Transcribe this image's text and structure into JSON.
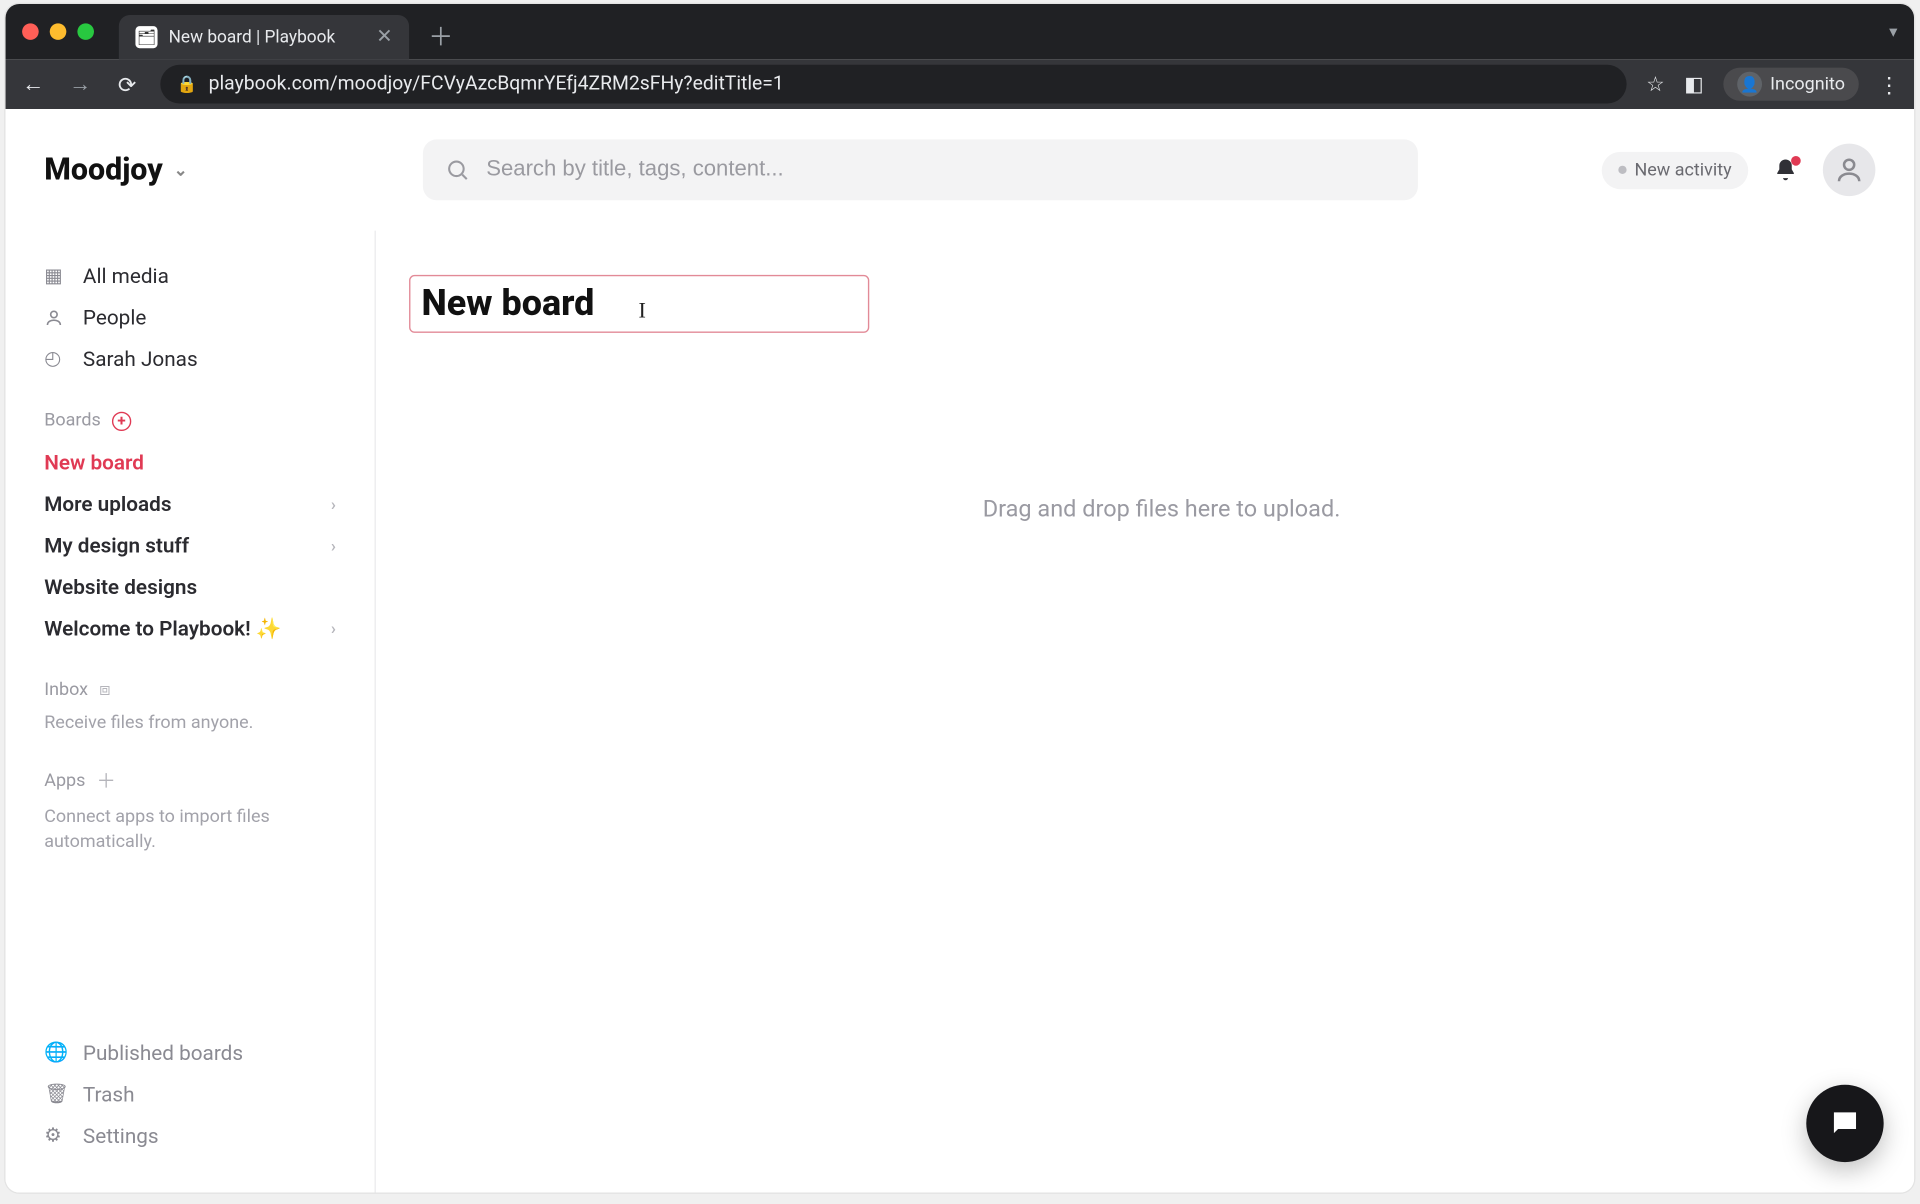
{
  "browser": {
    "tab_title": "New board | Playbook",
    "url": "playbook.com/moodjoy/FCVyAzcBqmrYEfj4ZRM2sFHy?editTitle=1",
    "incognito_label": "Incognito"
  },
  "header": {
    "workspace_name": "Moodjoy",
    "search_placeholder": "Search by title, tags, content...",
    "activity_label": "New activity"
  },
  "sidebar": {
    "nav": [
      {
        "icon": "grid",
        "label": "All media"
      },
      {
        "icon": "person",
        "label": "People"
      },
      {
        "icon": "clock",
        "label": "Sarah Jonas"
      }
    ],
    "boards_header": "Boards",
    "boards": [
      {
        "label": "New board",
        "active": true,
        "expandable": false
      },
      {
        "label": "More uploads",
        "active": false,
        "expandable": true
      },
      {
        "label": "My design stuff",
        "active": false,
        "expandable": true
      },
      {
        "label": "Website designs",
        "active": false,
        "expandable": false
      },
      {
        "label": "Welcome to Playbook! ✨",
        "active": false,
        "expandable": true
      }
    ],
    "inbox_header": "Inbox",
    "inbox_helper": "Receive files from anyone.",
    "apps_header": "Apps",
    "apps_helper": "Connect apps to import files automatically.",
    "bottom": [
      {
        "icon": "globe",
        "label": "Published boards"
      },
      {
        "icon": "trash",
        "label": "Trash"
      },
      {
        "icon": "gear",
        "label": "Settings"
      }
    ]
  },
  "main": {
    "title_value": "New board",
    "dropzone_text": "Drag and drop files here to upload."
  }
}
